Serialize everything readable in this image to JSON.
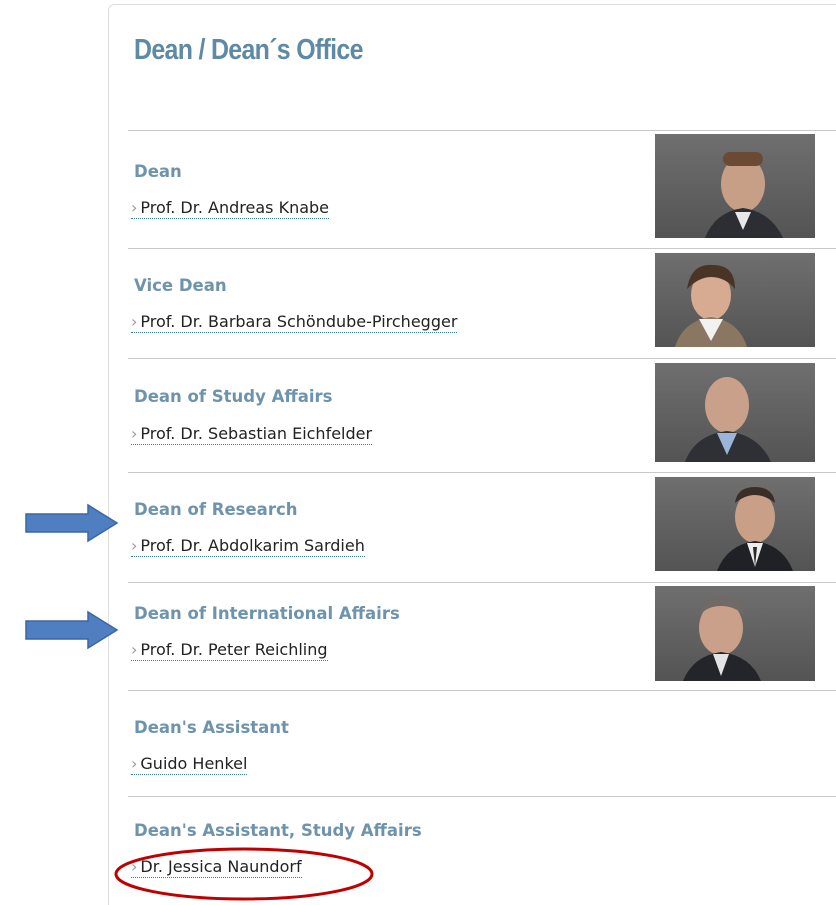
{
  "page": {
    "title": "Dean / Dean´s Office"
  },
  "colors": {
    "accent": "#5e8aa6",
    "link_underline": "#3a7fb0",
    "annotation_arrow": "#4f7fc1",
    "annotation_circle": "#c00000"
  },
  "entries": [
    {
      "role": "Dean",
      "name": "Prof. Dr. Andreas Knabe",
      "photo": "portrait-man"
    },
    {
      "role": "Vice Dean",
      "name": "Prof. Dr. Barbara Schöndube-Pirchegger",
      "photo": "portrait-woman"
    },
    {
      "role": "Dean of Study Affairs",
      "name": "Prof. Dr. Sebastian Eichfelder",
      "photo": "portrait-man"
    },
    {
      "role": "Dean of Research",
      "name": "Prof. Dr. Abdolkarim Sardieh",
      "photo": "portrait-man"
    },
    {
      "role": "Dean of International Affairs",
      "name": "Prof. Dr. Peter Reichling",
      "photo": "portrait-man"
    },
    {
      "role": "Dean's Assistant",
      "name": "Guido Henkel"
    },
    {
      "role": "Dean's Assistant, Study Affairs",
      "name": "Dr. Jessica Naundorf"
    }
  ],
  "link_marker": "›",
  "annotations": {
    "arrows": [
      "Dean of Research",
      "Dean of International Affairs"
    ],
    "circled": "Dr. Jessica Naundorf"
  }
}
